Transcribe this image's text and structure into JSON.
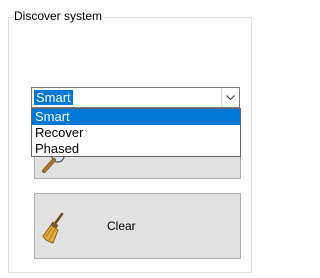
{
  "group": {
    "title": "Discover system"
  },
  "mode_combo": {
    "selected": "Smart",
    "arrow_icon": "chevron-down-icon",
    "options": [
      "Smart",
      "Recover",
      "Phased"
    ],
    "highlighted": "Smart"
  },
  "buttons": {
    "discover": {
      "label": "",
      "icon": "magnifier-icon"
    },
    "clear": {
      "label": "Clear",
      "icon": "broom-icon"
    }
  },
  "colors": {
    "selection": "#0078d7",
    "button_face": "#e1e1e1",
    "button_border": "#adadad",
    "group_border": "#dcdcdc"
  }
}
